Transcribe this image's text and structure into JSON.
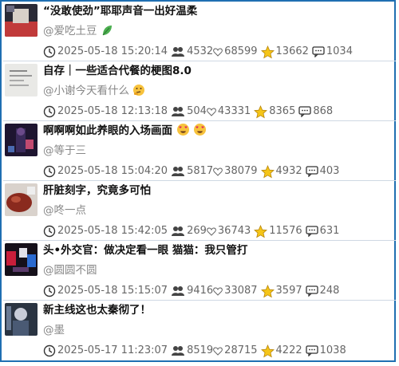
{
  "items": [
    {
      "title": "“没敢使劲”耶耶声音一出好温柔",
      "author": "@爱吃土豆",
      "author_emoji": "leaf",
      "time": "2025-05-18 15:20:14",
      "views": "4532",
      "likes": "68599",
      "stars": "13662",
      "comments": "1034"
    },
    {
      "title": "自存｜一些适合代餐的梗图8.0",
      "author": "@小谢今天看什么",
      "author_emoji": "thinking-face",
      "time": "2025-05-18 12:13:18",
      "views": "504",
      "likes": "43331",
      "stars": "8365",
      "comments": "868"
    },
    {
      "title": "啊啊啊如此养眼的入场画面",
      "title_emoji": "heart-eyes",
      "author": "@等于三",
      "time": "2025-05-18 15:04:20",
      "views": "5817",
      "likes": "38079",
      "stars": "4932",
      "comments": "403"
    },
    {
      "title": "肝脏刻字，究竟多可怕",
      "author": "@咚一点",
      "time": "2025-05-18 15:42:05",
      "views": "269",
      "likes": "36743",
      "stars": "11576",
      "comments": "631"
    },
    {
      "title": "头•外交官：做决定看一眼 猫猫：我只管打",
      "author": "@圆圆不圆",
      "time": "2025-05-18 15:15:07",
      "views": "9416",
      "likes": "33087",
      "stars": "3597",
      "comments": "248"
    },
    {
      "title": "新主线这也太秦彻了！",
      "author": "@墨",
      "time": "2025-05-17 11:23:07",
      "views": "8519",
      "likes": "28715",
      "stars": "4222",
      "comments": "1038"
    }
  ],
  "colors": {
    "frame": "#1f6fb2",
    "star": "#f5c518",
    "meta_text": "#666666"
  },
  "icons": [
    "clock-icon",
    "people-icon",
    "heart-icon",
    "star-icon",
    "comment-icon"
  ]
}
